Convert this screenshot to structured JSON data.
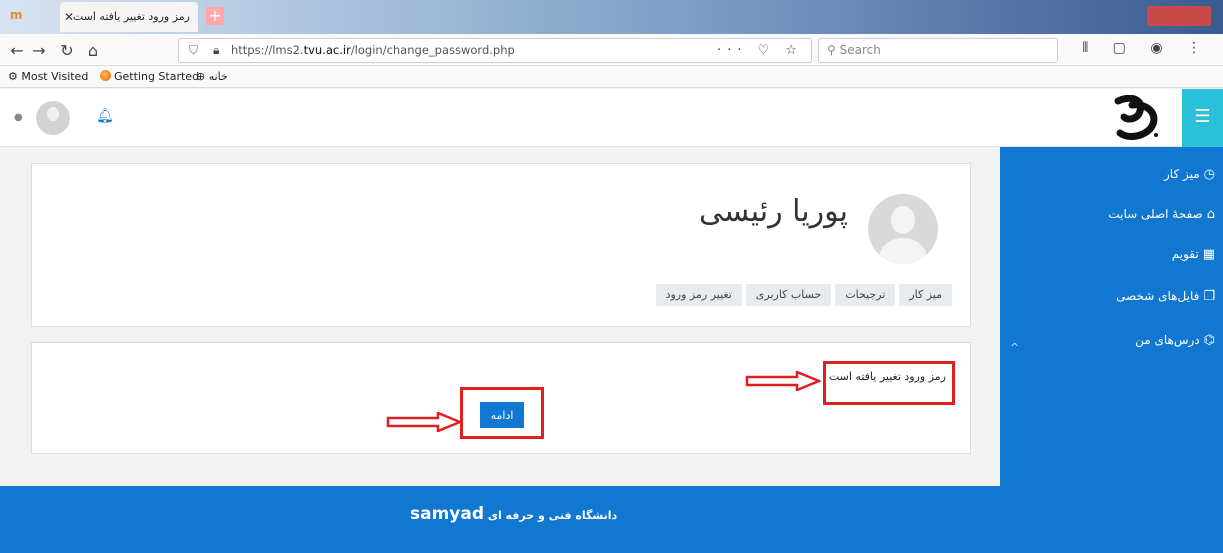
{
  "browser": {
    "tab_title": "رمز ورود تغییر یافته است",
    "tab_close": "✕",
    "new_tab": "+",
    "url_prefix": "https://lms2.",
    "url_domain": "tvu.ac.ir",
    "url_path": "/login/change_password.php",
    "url_actions": "··· ♡ ☆",
    "search_placeholder": "Search",
    "bookmarks": [
      "Most Visited",
      "Getting Started",
      "خانه"
    ]
  },
  "header": {
    "menu_icon": "☰"
  },
  "sidebar": {
    "items": [
      {
        "label": "میز کار",
        "icon": "dashboard-icon"
      },
      {
        "label": "صفحهٔ اصلی سایت",
        "icon": "home-icon"
      },
      {
        "label": "تقویم",
        "icon": "calendar-icon"
      },
      {
        "label": "فایل‌های شخصی",
        "icon": "files-icon"
      },
      {
        "label": "درس‌های من",
        "icon": "courses-icon"
      }
    ],
    "collapse_icon": "^"
  },
  "profile": {
    "name": "پوریا رئیسی",
    "breadcrumb": [
      "میز کار",
      "ترجیحات",
      "حساب کاربری",
      "تغییر رمز ورود"
    ]
  },
  "notice": {
    "message": "رمز ورود تغییر یافته است",
    "continue_label": "ادامه"
  },
  "footer": {
    "text": "دانشگاه فنی و حرفه ای",
    "brand": "samyad"
  },
  "colors": {
    "primary": "#1177d1",
    "toggle": "#2ac0d9",
    "highlight": "#e02020"
  }
}
